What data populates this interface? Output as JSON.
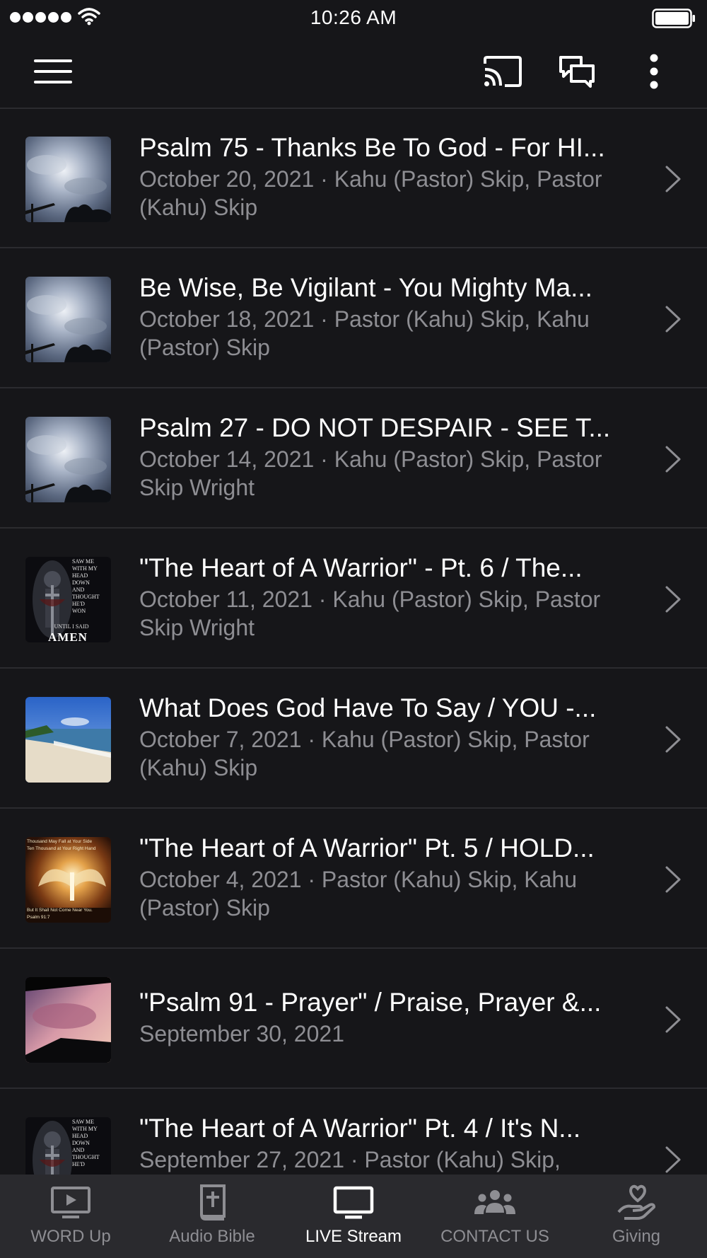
{
  "status_bar": {
    "time": "10:26 AM"
  },
  "items": [
    {
      "title": "Psalm 75 - Thanks Be To God - For HI...",
      "meta": "October 20, 2021 · Kahu (Pastor) Skip, Pastor (Kahu) Skip",
      "thumb": "cloud-sky"
    },
    {
      "title": "Be Wise, Be Vigilant - You Mighty Ma...",
      "meta": "October 18, 2021 · Pastor (Kahu) Skip, Kahu (Pastor) Skip",
      "thumb": "cloud-sky"
    },
    {
      "title": "Psalm 27 - DO NOT DESPAIR - SEE T...",
      "meta": "October 14, 2021 · Kahu (Pastor) Skip, Pastor Skip Wright",
      "thumb": "cloud-sky"
    },
    {
      "title": "\"The Heart of A Warrior\" - Pt. 6 / The...",
      "meta": "October 11, 2021 · Kahu (Pastor) Skip, Pastor Skip Wright",
      "thumb": "warrior",
      "thumb_text": [
        "SAW ME",
        "WITH MY",
        "HEAD",
        "DOWN",
        "AND",
        "THOUGHT",
        "HE'D",
        "WON",
        "UNTIL I SAID",
        "AMEN"
      ]
    },
    {
      "title": "What Does God Have To Say / YOU -...",
      "meta": "October 7, 2021 · Kahu (Pastor) Skip, Pastor (Kahu) Skip",
      "thumb": "beach"
    },
    {
      "title": "\"The Heart of A Warrior\" Pt. 5 / HOLD...",
      "meta": "October 4, 2021 · Pastor (Kahu) Skip, Kahu (Pastor) Skip",
      "thumb": "angel",
      "thumb_text": [
        "Thousand May Fall at Your Side",
        "Ten Thousand at Your Right Hand",
        "But It Shall Not Come Near You.",
        "Psalm 91:7"
      ]
    },
    {
      "title": "\"Psalm 91 - Prayer\" / Praise, Prayer &...",
      "meta": "September 30, 2021",
      "thumb": "sunset"
    },
    {
      "title": "\"The Heart of A Warrior\" Pt. 4 / It's N...",
      "meta": "September 27, 2021 · Pastor (Kahu) Skip,",
      "thumb": "warrior",
      "thumb_text": [
        "SAW ME",
        "WITH MY",
        "HEAD",
        "DOWN",
        "AND",
        "THOUGHT",
        "HE'D"
      ]
    }
  ],
  "tabs": [
    {
      "label": "WORD Up",
      "icon": "play-screen-icon",
      "active": false
    },
    {
      "label": "Audio Bible",
      "icon": "bible-icon",
      "active": false
    },
    {
      "label": "LIVE Stream",
      "icon": "tv-icon",
      "active": true
    },
    {
      "label": "CONTACT US",
      "icon": "group-icon",
      "active": false
    },
    {
      "label": "Giving",
      "icon": "giving-hand-icon",
      "active": false
    }
  ],
  "colors": {
    "background": "#161619",
    "tabbar": "#2a2a2e",
    "secondary_text": "#8e8e93",
    "divider": "#2b2b2f"
  }
}
